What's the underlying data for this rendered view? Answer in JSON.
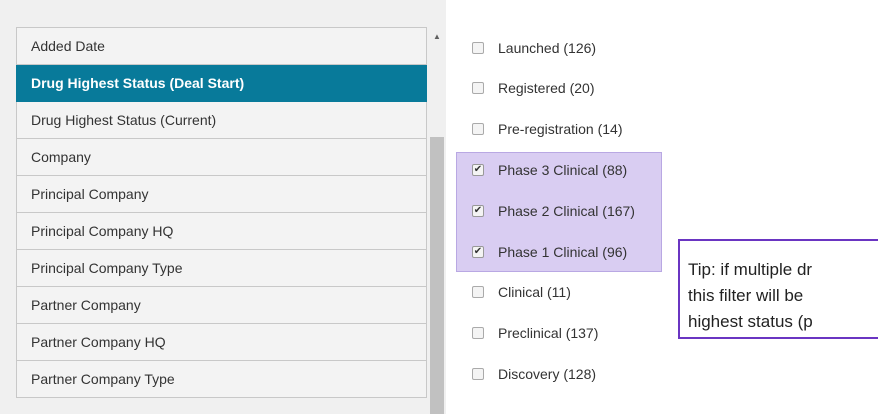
{
  "filters": [
    {
      "label": "Added Date",
      "selected": false
    },
    {
      "label": "Drug Highest Status (Deal Start)",
      "selected": true
    },
    {
      "label": "Drug Highest Status (Current)",
      "selected": false
    },
    {
      "label": "Company",
      "selected": false
    },
    {
      "label": "Principal Company",
      "selected": false
    },
    {
      "label": "Principal Company HQ",
      "selected": false
    },
    {
      "label": "Principal Company Type",
      "selected": false
    },
    {
      "label": "Partner Company",
      "selected": false
    },
    {
      "label": "Partner Company HQ",
      "selected": false
    },
    {
      "label": "Partner Company Type",
      "selected": false
    }
  ],
  "options": [
    {
      "label": "Launched (126)",
      "checked": false
    },
    {
      "label": "Registered (20)",
      "checked": false
    },
    {
      "label": "Pre-registration (14)",
      "checked": false
    },
    {
      "label": "Phase 3 Clinical (88)",
      "checked": true
    },
    {
      "label": "Phase 2 Clinical (167)",
      "checked": true
    },
    {
      "label": "Phase 1 Clinical (96)",
      "checked": true
    },
    {
      "label": "Clinical (11)",
      "checked": false
    },
    {
      "label": "Preclinical (137)",
      "checked": false
    },
    {
      "label": "Discovery (128)",
      "checked": false
    }
  ],
  "tip": {
    "lines": [
      "Tip: if multiple dr",
      "this filter will be",
      "highest status (p"
    ]
  },
  "colors": {
    "selected_bg": "#087a9a",
    "highlight_bg": "#d9cdf2",
    "tip_border": "#6a35c2"
  }
}
